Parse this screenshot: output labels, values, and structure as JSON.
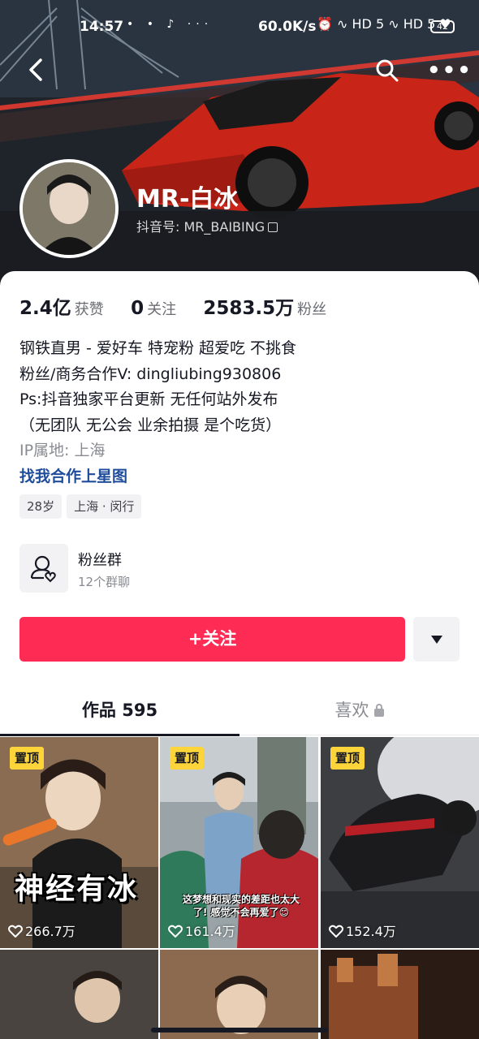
{
  "status_bar": {
    "time": "14:57",
    "dots": "• • ♪ ···",
    "network": "60.0K/s",
    "icons": "⏰ ∿ HD 5 ∿ HD 5 ♥",
    "battery": "42"
  },
  "header": {
    "back_icon": "chevron-left-icon",
    "search_icon": "search-icon",
    "more_icon": "more-icon",
    "more_label": "•••"
  },
  "profile": {
    "name": "MR-白冰",
    "douyin_id": "抖音号: MR_BAIBING"
  },
  "stats": [
    {
      "num": "2.4亿",
      "label": "获赞"
    },
    {
      "num": "0",
      "label": "关注"
    },
    {
      "num": "2583.5万",
      "label": "粉丝"
    }
  ],
  "bio": {
    "line1": "钢铁直男 - 爱好车 特宠粉 超爱吃 不挑食",
    "line2": "粉丝/商务合作V: dingliubing930806",
    "line3": "Ps:抖音独家平台更新 无任何站外发布",
    "line4": "（无团队 无公会 业余拍摄 是个吃货）",
    "ip": "IP属地: 上海",
    "link": "找我合作上星图"
  },
  "tags": [
    "28岁",
    "上海 · 闵行"
  ],
  "fans_group": {
    "title": "粉丝群",
    "subtitle": "12个群聊"
  },
  "actions": {
    "follow": "+关注"
  },
  "tabs": {
    "works": "作品 595",
    "likes": "喜欢"
  },
  "videos": [
    {
      "pinned": "置顶",
      "likes": "266.7万",
      "caption": "神经有冰"
    },
    {
      "pinned": "置顶",
      "likes": "161.4万",
      "subtitle": "这梦想和现实的差距也太大了! 感觉不会再爱了😊"
    },
    {
      "pinned": "置顶",
      "likes": "152.4万"
    }
  ],
  "colors": {
    "accent": "#fe2c55",
    "pin": "#fdd53a",
    "link": "#1f4d9c"
  }
}
